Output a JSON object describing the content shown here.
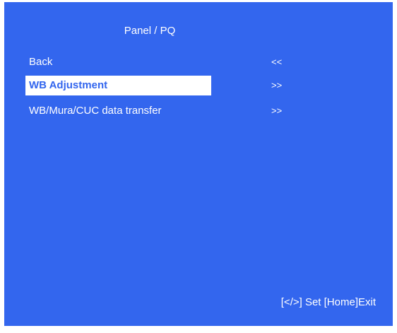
{
  "menu": {
    "title": "Panel / PQ",
    "items": [
      {
        "label": "Back",
        "arrow": "<<"
      },
      {
        "label": "WB Adjustment",
        "arrow": ">>"
      },
      {
        "label": "WB/Mura/CUC data transfer",
        "arrow": ">>"
      }
    ],
    "selected_index": 1
  },
  "footer": {
    "hint": "[</>] Set [Home]Exit"
  },
  "colors": {
    "panel_background": "#3366ee",
    "text": "#ffffff",
    "highlight_background": "#ffffff",
    "highlight_text": "#3366ee"
  }
}
